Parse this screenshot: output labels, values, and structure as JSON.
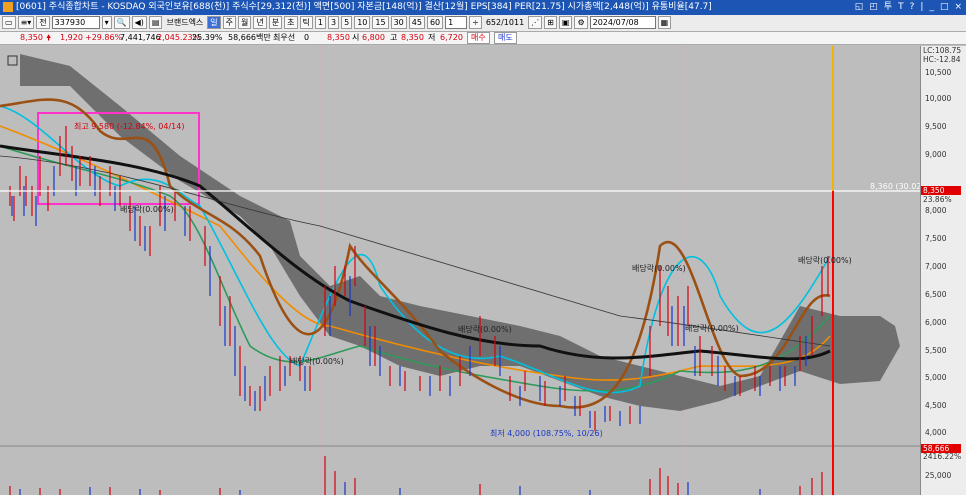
{
  "titlebar": {
    "text": "[0601] 주식종합차트 - KOSDAQ 외국인보유[688(천)] 주식수[29,312(천)] 액면[500] 자본금[148(억)] 결산[12월] EPS[384] PER[21.75] 시가총액[2,448(억)] 유통비율[47.7]",
    "controls": [
      "◱",
      "◰",
      "투",
      "T",
      "?",
      "|",
      "_",
      "□",
      "×"
    ]
  },
  "toolbar": {
    "period_label": "전",
    "stock_code": "337930",
    "name_tag": "브랜드엑스",
    "period_buttons": [
      "주",
      "월",
      "년",
      "분",
      "초",
      "틱",
      "1",
      "3",
      "5",
      "10",
      "15",
      "30",
      "45",
      "60"
    ],
    "count_value": "1",
    "range_text": "652/1011",
    "date_value": "2024/07/08"
  },
  "quote": {
    "price": "8,350",
    "change": "1,920",
    "change_pct": "+29.86%",
    "volume": "7,441,746",
    "volume_pct": "2,045.23%",
    "turnover": "25.39%",
    "amount": "58,666백만",
    "pref_label": "최우선",
    "pref_value": "0",
    "pref_price": "8,350",
    "open_label": "시",
    "open": "6,800",
    "high_label": "고",
    "high": "8,350",
    "low_label": "저",
    "low": "6,720",
    "buy_label": "매수",
    "sell_label": "매도"
  },
  "axis": {
    "lc": "LC:108.75",
    "hc": "HC:-12.84",
    "ticks": [
      "10,500",
      "10,000",
      "9,500",
      "9,000",
      "8,500",
      "8,000",
      "7,500",
      "7,000",
      "6,500",
      "6,000",
      "5,500",
      "5,000",
      "4,500",
      "4,000"
    ],
    "current_price": "8,350",
    "current_pct": "23.86%",
    "vol_current": "58,666",
    "vol_pct": "2416.22%",
    "vol_tick": "25,000"
  },
  "annotations": {
    "high_marker": "최고 9,580 (-12.84%, 04/14)",
    "low_marker": "최저 4,000 (108.75%, 10/26)",
    "price_line": "8,360 (30.02%)",
    "dividend_1": "배당락(0.00%)",
    "dividend_2": "배당락(0.00%)",
    "dividend_3": "배당락(0.00%)",
    "dividend_4": "배당락(0.00%)",
    "dividend_5": "배당락(0.00%)",
    "dividend_6": "배당락(0.00%)"
  },
  "colors": {
    "titlebar": "#1c55b4",
    "up": "#d4000e",
    "down": "#1836c8",
    "highlight_box": "#ff33cc",
    "current_bar": "#f0b400"
  }
}
